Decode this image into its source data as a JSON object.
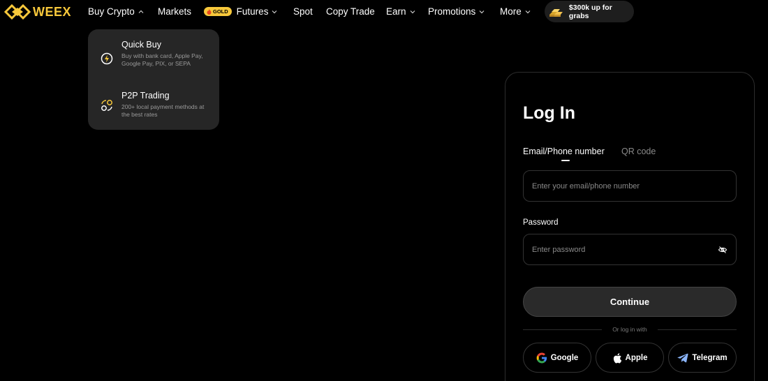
{
  "brand": {
    "name": "WEEX",
    "color": "#f7c83b",
    "logo_icon": "weex-diamond-logo"
  },
  "nav": {
    "items": [
      {
        "label": "Buy Crypto",
        "has_chevron": true,
        "open": true
      },
      {
        "label": "Markets"
      },
      {
        "label": "Futures",
        "badge": "GOLD",
        "badge_icon": "fire-icon",
        "has_chevron": true
      },
      {
        "label": "Spot"
      },
      {
        "label": "Copy Trade"
      },
      {
        "label": "Earn",
        "has_chevron": true
      },
      {
        "label": "Promotions",
        "has_chevron": true
      },
      {
        "label": "More",
        "has_chevron": true
      }
    ],
    "promo": {
      "label": "$300k up for grabs",
      "icon": "gold-bars-icon"
    }
  },
  "dropdown": {
    "items": [
      {
        "title": "Quick Buy",
        "desc": "Buy with bank card, Apple Pay, Google Pay, PIX, or SEPA",
        "icon": "lightning-circle-icon"
      },
      {
        "title": "P2P Trading",
        "desc": "200+ local payment methods at the best rates",
        "icon": "p2p-exchange-icon"
      }
    ]
  },
  "login": {
    "title": "Log In",
    "tabs": [
      {
        "label": "Email/Phone number",
        "active": true
      },
      {
        "label": "QR code",
        "active": false
      }
    ],
    "email_placeholder": "Enter your email/phone number",
    "password_label": "Password",
    "password_placeholder": "Enter password",
    "continue_label": "Continue",
    "or_text": "Or log in with",
    "social": [
      {
        "label": "Google",
        "icon": "google-icon"
      },
      {
        "label": "Apple",
        "icon": "apple-icon"
      },
      {
        "label": "Telegram",
        "icon": "telegram-icon"
      }
    ]
  }
}
